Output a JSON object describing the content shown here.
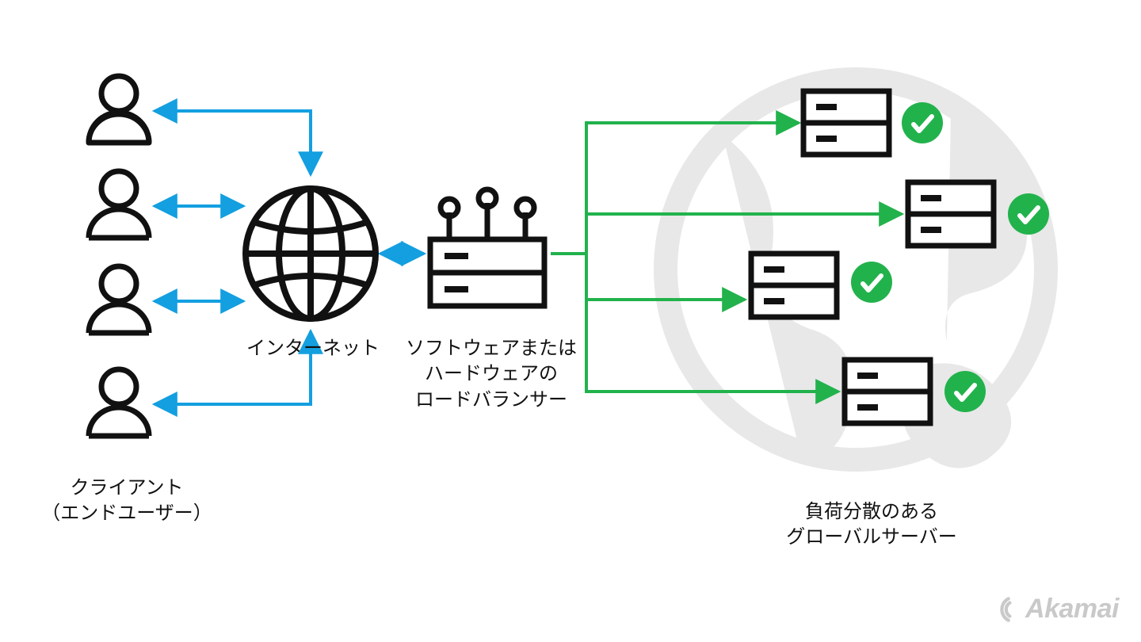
{
  "labels": {
    "clients": "クライアント\n（エンドユーザー）",
    "internet": "インターネット",
    "loadbalancer": "ソフトウェアまたは\nハードウェアの\nロードバランサー",
    "servers": "負荷分散のある\nグローバルサーバー"
  },
  "brand": "Akamai",
  "colors": {
    "line_blue": "#139fe0",
    "line_green": "#22b24c",
    "globe_gray": "#e8e8e8",
    "icon_black": "#111111",
    "check_green": "#22b24c",
    "brand_gray": "#c9c9c9"
  },
  "diagram": {
    "nodes": [
      {
        "id": "client-1",
        "type": "person"
      },
      {
        "id": "client-2",
        "type": "person"
      },
      {
        "id": "client-3",
        "type": "person"
      },
      {
        "id": "client-4",
        "type": "person"
      },
      {
        "id": "internet",
        "type": "globe"
      },
      {
        "id": "loadbalancer",
        "type": "load-balancer"
      },
      {
        "id": "server-1",
        "type": "server",
        "status": "ok"
      },
      {
        "id": "server-2",
        "type": "server",
        "status": "ok"
      },
      {
        "id": "server-3",
        "type": "server",
        "status": "ok"
      },
      {
        "id": "server-4",
        "type": "server",
        "status": "ok"
      }
    ],
    "edges": [
      {
        "from": "client-1",
        "to": "internet",
        "color": "blue",
        "bidir": true
      },
      {
        "from": "client-2",
        "to": "internet",
        "color": "blue",
        "bidir": true
      },
      {
        "from": "client-3",
        "to": "internet",
        "color": "blue",
        "bidir": true
      },
      {
        "from": "client-4",
        "to": "internet",
        "color": "blue",
        "bidir": true
      },
      {
        "from": "internet",
        "to": "loadbalancer",
        "color": "blue",
        "bidir": true
      },
      {
        "from": "loadbalancer",
        "to": "server-1",
        "color": "green",
        "bidir": false
      },
      {
        "from": "loadbalancer",
        "to": "server-2",
        "color": "green",
        "bidir": false
      },
      {
        "from": "loadbalancer",
        "to": "server-3",
        "color": "green",
        "bidir": false
      },
      {
        "from": "loadbalancer",
        "to": "server-4",
        "color": "green",
        "bidir": false
      }
    ]
  }
}
